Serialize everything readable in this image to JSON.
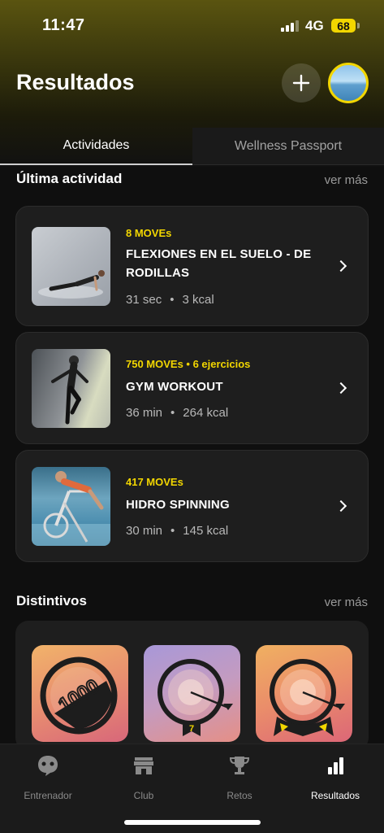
{
  "status_bar": {
    "time": "11:47",
    "network": "4G",
    "battery": "68"
  },
  "header": {
    "title": "Resultados",
    "add_icon": "plus-icon",
    "avatar_icon": "profile-avatar"
  },
  "tabs": [
    {
      "label": "Actividades",
      "active": true
    },
    {
      "label": "Wellness Passport",
      "active": false
    }
  ],
  "last_activity": {
    "title": "Última actividad",
    "see_more": "ver más",
    "items": [
      {
        "moves": "8 MOVEs",
        "name": "FLEXIONES EN EL SUELO - DE RODILLAS",
        "duration": "31 sec",
        "kcal": "3 kcal",
        "image_icon": "pushup-photo"
      },
      {
        "moves": "750 MOVEs  •  6 ejercicios",
        "name": "GYM WORKOUT",
        "duration": "36 min",
        "kcal": "264 kcal",
        "image_icon": "gym-photo"
      },
      {
        "moves": "417 MOVEs",
        "name": "HIDRO SPINNING",
        "duration": "30 min",
        "kcal": "145 kcal",
        "image_icon": "underwater-bike-photo"
      }
    ],
    "separator": "•"
  },
  "badges": {
    "title": "Distintivos",
    "see_more": "ver más",
    "items": [
      {
        "icon": "1000-moves-badge",
        "label": "1000"
      },
      {
        "icon": "target-badge",
        "label": "7"
      },
      {
        "icon": "target-ribbon-badge",
        "label": ""
      }
    ]
  },
  "bottom_nav": [
    {
      "label": "Entrenador",
      "icon": "chat-face-icon",
      "active": false
    },
    {
      "label": "Club",
      "icon": "store-icon",
      "active": false
    },
    {
      "label": "Retos",
      "icon": "trophy-icon",
      "active": false
    },
    {
      "label": "Resultados",
      "icon": "bar-chart-icon",
      "active": true
    }
  ],
  "colors": {
    "accent": "#f2d600",
    "background": "#0f0f0f",
    "card": "#1e1e1e"
  }
}
